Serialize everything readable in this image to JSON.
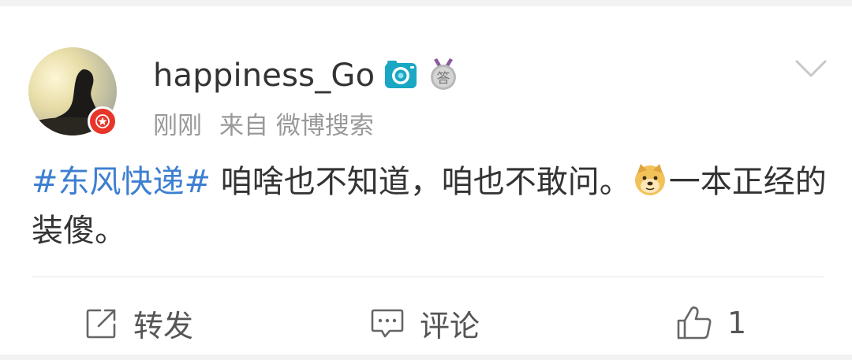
{
  "post": {
    "author": {
      "name": "happiness_Go",
      "avatar_icon": "person-silhouette-sunset",
      "badges": [
        "camera-icon",
        "medal-icon"
      ],
      "medal_text": "答",
      "vip_icon": "star-badge-icon"
    },
    "meta": {
      "time": "刚刚",
      "source": "来自 微博搜索"
    },
    "content": {
      "topic": "#东风快递#",
      "text_part1": " 咱啥也不知道，咱也不敢问。",
      "emoji": "doge-emoji",
      "text_part2": "一本正经的装傻。"
    },
    "actions": {
      "repost_label": "转发",
      "comment_label": "评论",
      "like_count": "1"
    },
    "colors": {
      "topic": "#3d7fd1",
      "text": "#333333",
      "meta": "#999999",
      "vip_badge": "#e8352a",
      "camera": "#1aa7c4"
    }
  }
}
